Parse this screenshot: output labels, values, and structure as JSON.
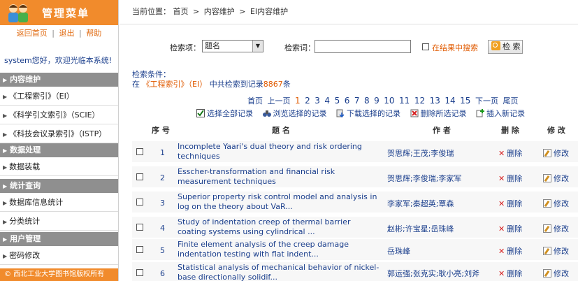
{
  "sidebar": {
    "title": "管理菜单",
    "links": [
      "返回首页",
      "退出",
      "帮助"
    ],
    "link_separator": "|",
    "welcome": "system您好，欢迎光临本系统!",
    "sections": [
      {
        "label": "内容维护",
        "items": [
          "《工程索引》（EI）",
          "《科学引文索引》（SCIE）",
          "《科技会议录索引》（ISTP）"
        ]
      },
      {
        "label": "数据处理",
        "items": [
          "数据装载"
        ]
      },
      {
        "label": "统计查询",
        "items": [
          "数据库信息统计",
          "分类统计"
        ]
      },
      {
        "label": "用户管理",
        "items": [
          "密码修改"
        ]
      }
    ],
    "footer": "© 西北工业大学图书馆版权所有"
  },
  "breadcrumb": {
    "prefix": "当前位置：",
    "items": [
      "首页",
      "内容维护",
      "EI内容维护"
    ],
    "separator": ">"
  },
  "search": {
    "field_label": "检索项：",
    "field_value": "题名",
    "term_label": "检索词：",
    "term_value": "",
    "within_label": "在结果中搜索",
    "button_label": "检 索"
  },
  "conditions": {
    "label": "检索条件：",
    "prefix": "在",
    "source": "《工程索引》（EI）",
    "middle": "中共检索到记录",
    "count": "8867",
    "suffix": "条"
  },
  "pager": {
    "first": "首页",
    "prev": "上一页",
    "pages": [
      "1",
      "2",
      "3",
      "4",
      "5",
      "6",
      "7",
      "8",
      "9",
      "10",
      "11",
      "12",
      "13",
      "14",
      "15"
    ],
    "current": "1",
    "next": "下一页",
    "last": "尾页"
  },
  "actions": {
    "select_all": "选择全部记录",
    "browse": "浏览选择的记录",
    "download": "下载选择的记录",
    "delete_selected": "删除所选记录",
    "insert": "插入新记录"
  },
  "table": {
    "headers": {
      "num": "序 号",
      "title": "题 名",
      "author": "作 者",
      "delete": "删 除",
      "modify": "修 改"
    },
    "delete_label": "删除",
    "modify_label": "修改",
    "rows": [
      {
        "num": "1",
        "title": "Incomplete Yaari's dual theory and risk ordering techniques",
        "author": "贺思辉;王茂;李俊瑞"
      },
      {
        "num": "2",
        "title": "Esscher-transformation and financial risk measurement techniques",
        "author": "贺思辉;李俊瑞;李家军"
      },
      {
        "num": "3",
        "title": "Superior property risk control model and analysis in log on the theory about VaR...",
        "author": "李家军;秦超英;覃森"
      },
      {
        "num": "4",
        "title": "Study of indentation creep of thermal barrier coating systems using cylindrical ...",
        "author": "赵彬;许宝星;岳珠峰"
      },
      {
        "num": "5",
        "title": "Finite element analysis of the creep damage indentation testing with flat indent...",
        "author": "岳珠峰"
      },
      {
        "num": "6",
        "title": "Statistical analysis of mechanical behavior of nickel-base directionally solidif...",
        "author": "郭运强;张克实;耿小亮;刘斧"
      }
    ]
  },
  "colors": {
    "accent": "#f18b2c",
    "link": "#1a3e8c",
    "highlight": "#e05a00",
    "section_bg": "#8f8f8f"
  }
}
